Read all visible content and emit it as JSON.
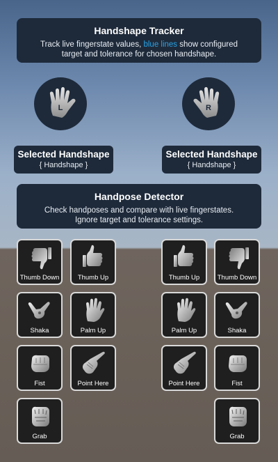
{
  "tracker": {
    "title": "Handshape Tracker",
    "desc_before": "Track live fingerstate values, ",
    "desc_accent": "blue lines",
    "desc_after": " show configured",
    "desc_line2": "target and tolerance for chosen handshape.",
    "accent_color": "#29a3e6"
  },
  "hands": {
    "left_label": "L",
    "right_label": "R"
  },
  "selected": {
    "left": {
      "title": "Selected Handshape",
      "value": "{ Handshape }"
    },
    "right": {
      "title": "Selected Handshape",
      "value": "{ Handshape }"
    }
  },
  "detector": {
    "title": "Handpose Detector",
    "line1": "Check handposes and compare with live fingerstates.",
    "line2": "Ignore target and tolerance settings."
  },
  "left_poses": [
    {
      "label": "Thumb Down",
      "icon": "thumb-down-icon"
    },
    {
      "label": "Thumb Up",
      "icon": "thumb-up-icon"
    },
    {
      "label": "Shaka",
      "icon": "shaka-icon"
    },
    {
      "label": "Palm Up",
      "icon": "palm-up-icon"
    },
    {
      "label": "Fist",
      "icon": "fist-icon"
    },
    {
      "label": "Point Here",
      "icon": "point-here-icon"
    },
    {
      "label": "Grab",
      "icon": "grab-icon"
    }
  ],
  "right_poses": [
    {
      "label": "Thumb Up",
      "icon": "thumb-up-icon"
    },
    {
      "label": "Thumb Down",
      "icon": "thumb-down-icon"
    },
    {
      "label": "Palm Up",
      "icon": "palm-up-icon"
    },
    {
      "label": "Shaka",
      "icon": "shaka-icon"
    },
    {
      "label": "Point Here",
      "icon": "point-here-icon"
    },
    {
      "label": "Fist",
      "icon": "fist-icon"
    },
    {
      "label": "Grab",
      "icon": "grab-icon"
    }
  ]
}
